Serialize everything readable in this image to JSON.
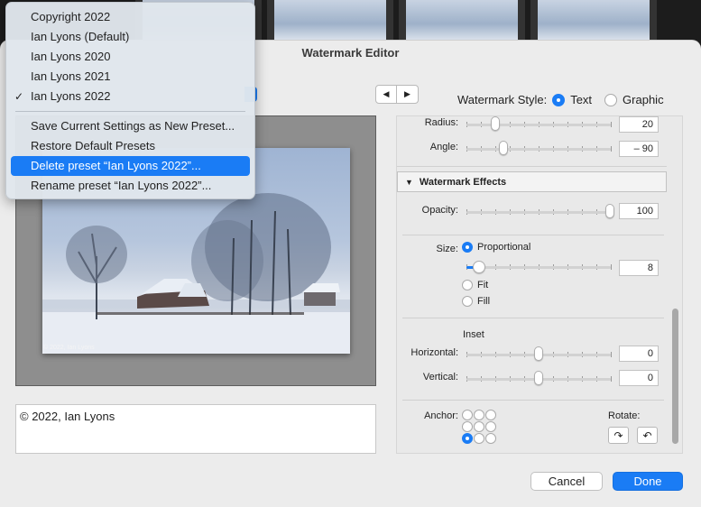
{
  "dialog": {
    "title": "Watermark Editor"
  },
  "preset_menu": {
    "items": [
      {
        "label": "Copyright 2022",
        "checked": false
      },
      {
        "label": "Ian Lyons (Default)",
        "checked": false
      },
      {
        "label": "Ian Lyons 2020",
        "checked": false
      },
      {
        "label": "Ian Lyons 2021",
        "checked": false
      },
      {
        "label": "Ian Lyons 2022",
        "checked": true,
        "check_glyph": "✓"
      }
    ],
    "actions": [
      {
        "label": "Save Current Settings as New Preset...",
        "highlighted": false
      },
      {
        "label": "Restore Default Presets",
        "highlighted": false
      },
      {
        "label": "Delete preset “Ian Lyons 2022”...",
        "highlighted": true
      },
      {
        "label": "Rename preset “Ian Lyons 2022”...",
        "highlighted": false
      }
    ]
  },
  "nav": {
    "prev_glyph": "◀",
    "next_glyph": "▶"
  },
  "watermark_style": {
    "label": "Watermark Style:",
    "options": [
      {
        "label": "Text",
        "selected": true
      },
      {
        "label": "Graphic",
        "selected": false
      }
    ]
  },
  "preview": {
    "watermark_text": "© 2022, Ian Lyons"
  },
  "caption": {
    "text": "© 2022, Ian Lyons"
  },
  "shadow": {
    "radius": {
      "label": "Radius:",
      "value": "20",
      "level": 0.2
    },
    "angle": {
      "label": "Angle:",
      "value": "– 90",
      "level": 0.25
    }
  },
  "effects": {
    "header": "Watermark Effects",
    "opacity": {
      "label": "Opacity:",
      "value": "100",
      "level": 1.0
    },
    "size": {
      "label": "Size:",
      "options": [
        {
          "label": "Proportional",
          "selected": true
        },
        {
          "label": "Fit",
          "selected": false
        },
        {
          "label": "Fill",
          "selected": false
        }
      ],
      "value": "8",
      "level": 0.08
    },
    "inset": {
      "label": "Inset",
      "horizontal": {
        "label": "Horizontal:",
        "value": "0",
        "level": 0.5
      },
      "vertical": {
        "label": "Vertical:",
        "value": "0",
        "level": 0.5
      }
    },
    "anchor": {
      "label": "Anchor:",
      "selected_index": 6
    },
    "rotate": {
      "label": "Rotate:",
      "cw_glyph": "↷",
      "ccw_glyph": "↶"
    }
  },
  "buttons": {
    "cancel": "Cancel",
    "done": "Done"
  },
  "colors": {
    "accent": "#1a7cf5",
    "dialog_bg": "#ececec"
  }
}
